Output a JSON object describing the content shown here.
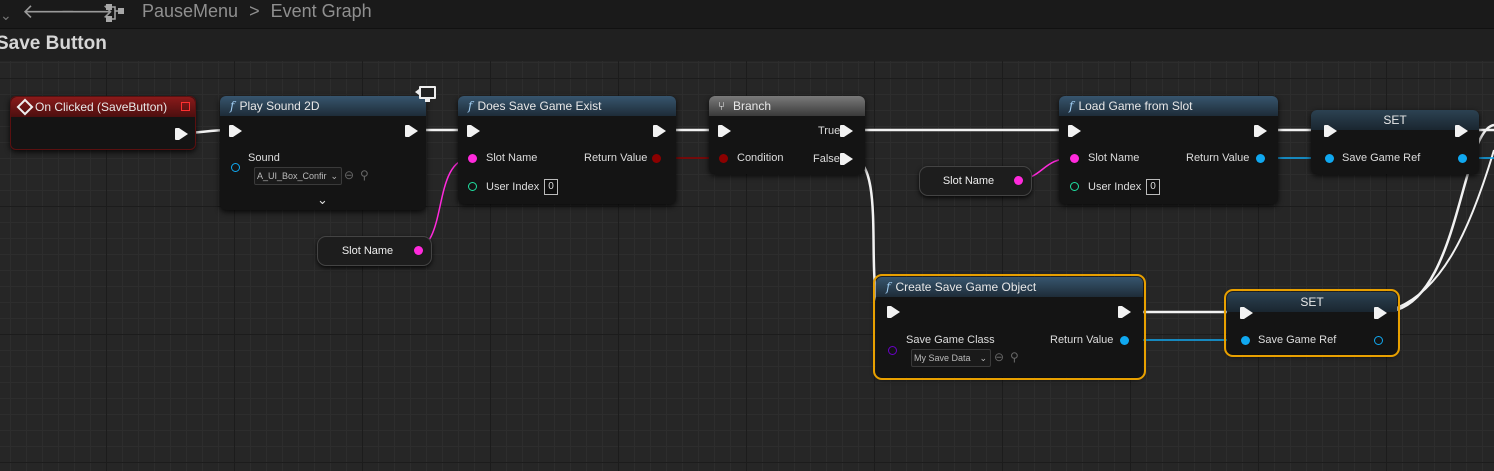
{
  "toolbar": {
    "back_icon": "arrow-left-icon",
    "forward_icon": "arrow-right-icon",
    "graph_icon": "blueprint-graph-icon"
  },
  "breadcrumb": {
    "root": "PauseMenu",
    "separator": ">",
    "leaf": "Event Graph"
  },
  "graph_title": "Save Button",
  "colors": {
    "exec": "#f2f2f2",
    "string_pin": "#ff2adc",
    "bool_pin": "#8c0000",
    "int_pin": "#1fe0a0",
    "object_pin": "#10a8f0",
    "class_pin": "#6a00c8",
    "selection": "#e8a000"
  },
  "nodes": {
    "on_clicked": {
      "title": "On Clicked (SaveButton)"
    },
    "play_sound": {
      "title": "Play Sound 2D",
      "sound_label": "Sound",
      "sound_value": "A_UI_Box_Confir",
      "expand": "⌄"
    },
    "does_exist": {
      "title": "Does Save Game Exist",
      "slot_name": "Slot Name",
      "return_value": "Return Value",
      "user_index": "User Index",
      "user_index_value": "0"
    },
    "branch": {
      "title": "Branch",
      "true_label": "True",
      "condition": "Condition",
      "false_label": "False"
    },
    "load_game": {
      "title": "Load Game from Slot",
      "slot_name": "Slot Name",
      "return_value": "Return Value",
      "user_index": "User Index",
      "user_index_value": "0"
    },
    "set_top": {
      "title": "SET",
      "pin": "Save Game Ref"
    },
    "create_save": {
      "title": "Create Save Game Object",
      "class_label": "Save Game Class",
      "class_value": "My Save Data",
      "return_value": "Return Value"
    },
    "set_bottom": {
      "title": "SET",
      "pin": "Save Game Ref"
    }
  },
  "variables": {
    "slot_name_1": "Slot Name",
    "slot_name_2": "Slot Name"
  }
}
